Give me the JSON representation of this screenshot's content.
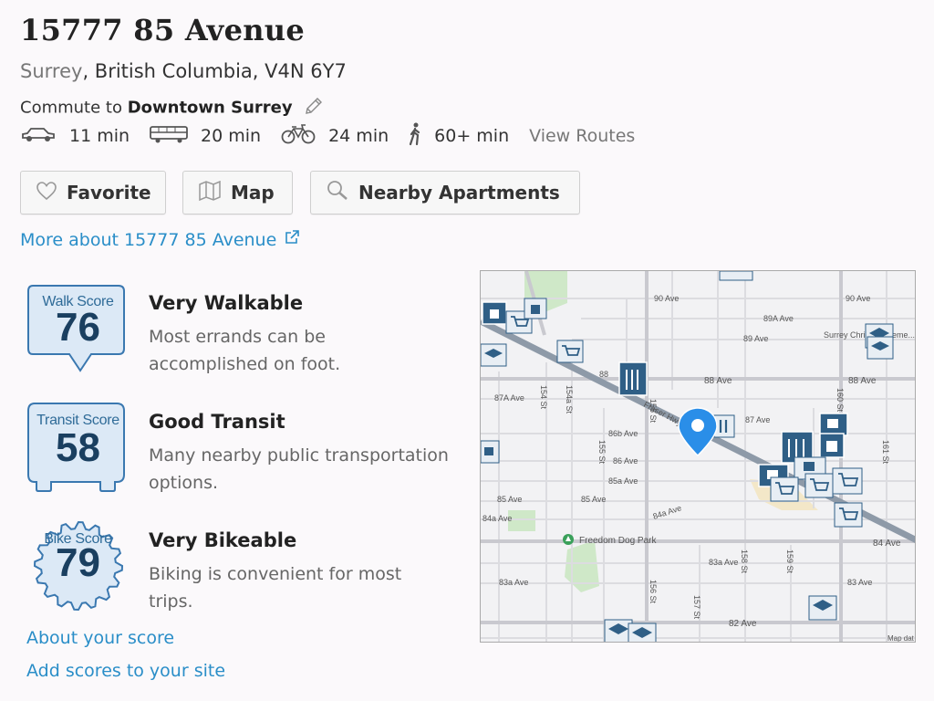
{
  "header": {
    "title": "15777 85 Avenue",
    "city": "Surrey",
    "address_rest": ", British Columbia, V4N 6Y7",
    "commute_prefix": "Commute to ",
    "commute_destination": "Downtown Surrey"
  },
  "commute_modes": [
    {
      "icon": "car-icon",
      "label": "11 min"
    },
    {
      "icon": "bus-icon",
      "label": "20 min"
    },
    {
      "icon": "bicycle-icon",
      "label": "24 min"
    },
    {
      "icon": "walking-person-icon",
      "label": "60+ min"
    }
  ],
  "view_routes_label": "View Routes",
  "buttons": {
    "favorite": "Favorite",
    "map": "Map",
    "nearby": "Nearby Apartments"
  },
  "more_about": "More about 15777 85 Avenue",
  "scores": {
    "walk": {
      "badge_label": "Walk Score",
      "value": "76",
      "heading": "Very Walkable",
      "desc": "Most errands can be accomplished on foot."
    },
    "transit": {
      "badge_label": "Transit Score",
      "value": "58",
      "heading": "Good Transit",
      "desc": "Many nearby public transportation options."
    },
    "bike": {
      "badge_label": "Bike Score",
      "value": "79",
      "heading": "Very Bikeable",
      "desc": "Biking is convenient for most trips."
    }
  },
  "links": {
    "about_score": "About your score",
    "add_scores": "Add scores to your site"
  },
  "map": {
    "labels": {
      "ave90": "90 Ave",
      "ave90b": "90 Ave",
      "ave89a": "89A Ave",
      "ave89": "89 Ave",
      "ave88a": "88",
      "ave88b": "88 Ave",
      "ave88c": "88 Ave",
      "ave87a": "87A Ave",
      "ave87": "87 Ave",
      "ave86b": "86b Ave",
      "ave86": "86 Ave",
      "ave85a": "85a Ave",
      "ave85": "85 Ave",
      "ave85b": "85 Ave",
      "ave84a": "84a Ave",
      "ave84a2": "84a Ave",
      "ave84": "84 Ave",
      "ave83a": "83a Ave",
      "ave83a2": "83a Ave",
      "ave83": "83 Ave",
      "ave82": "82 Ave",
      "st156": "156 St",
      "st156b": "156 St",
      "st154": "154 St",
      "st154a": "154a St",
      "st155": "155 St",
      "st157": "157 St",
      "st158": "158 St",
      "st159": "159 St",
      "st160": "160 St",
      "st161": "161 St",
      "fraser": "Fraser Hwy",
      "park": "Freedom Dog Park",
      "school": "Surrey Christian Eleme...",
      "attribution": "Map dat"
    }
  }
}
